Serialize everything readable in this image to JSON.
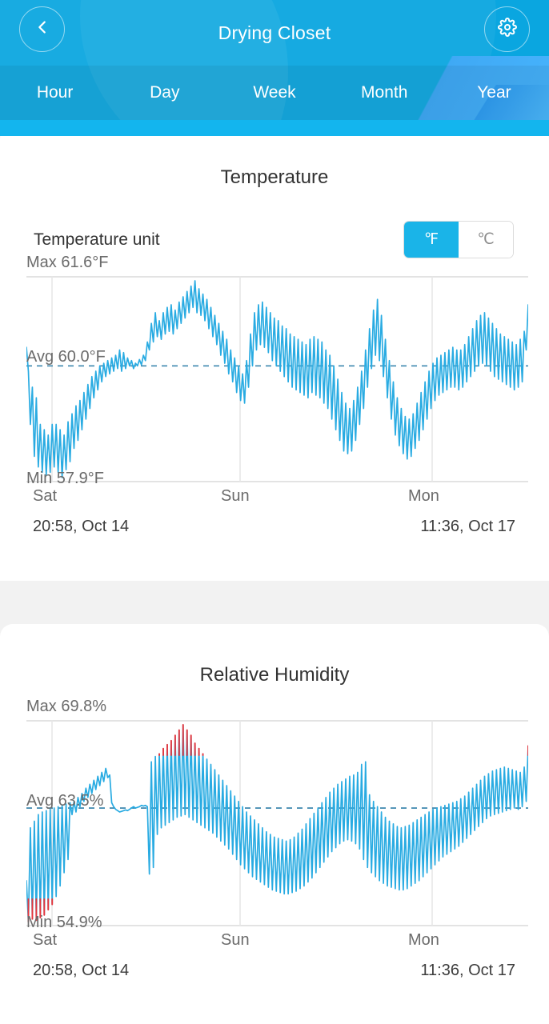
{
  "header": {
    "title": "Drying Closet",
    "back_icon": "chevron-left-icon",
    "settings_icon": "gear-icon",
    "accent": "#0aa6e0",
    "tabs": [
      {
        "label": "Hour",
        "selected": false
      },
      {
        "label": "Day",
        "selected": false
      },
      {
        "label": "Week",
        "selected": false
      },
      {
        "label": "Month",
        "selected": false
      },
      {
        "label": "Year",
        "selected": false
      }
    ]
  },
  "temperature": {
    "title": "Temperature",
    "unit_label": "Temperature unit",
    "unit_options": [
      {
        "label": "℉",
        "selected": true
      },
      {
        "label": "℃",
        "selected": false
      }
    ],
    "max_label": "Max 61.6°F",
    "avg_label": "Avg 60.0°F",
    "min_label": "Min 57.9°F",
    "axis": {
      "left_day": "Sat",
      "left_time": "20:58,  Oct 14",
      "mid_day": "Sun",
      "right_day": "Mon",
      "right_time": "11:36,  Oct 17"
    }
  },
  "humidity": {
    "title": "Relative Humidity",
    "max_label": "Max 69.8%",
    "avg_label": "Avg 63.5%",
    "min_label": "Min 54.9%",
    "axis": {
      "left_day": "Sat",
      "left_time": "20:58,  Oct 14",
      "mid_day": "Sun",
      "right_day": "Mon",
      "right_time": "11:36,  Oct 17"
    }
  },
  "chart_data": [
    {
      "type": "line",
      "title": "Temperature",
      "ylabel": "°F",
      "xlabel": "",
      "grid": true,
      "legend": "none",
      "series_color": "#29abe2",
      "avg_line_style": "dashed",
      "ylim": [
        57.9,
        61.6
      ],
      "stats": {
        "max": 61.6,
        "avg": 60.0,
        "min": 57.9,
        "unit": "°F"
      },
      "xticks": [
        "Sat",
        "Sun",
        "Mon"
      ],
      "xtick_sublabels": [
        "20:58,  Oct 14",
        "",
        "11:36,  Oct 17"
      ],
      "x_range": [
        "2023-10-14 20:58",
        "2023-10-17 11:36"
      ],
      "series": [
        {
          "name": "Temperature",
          "values": [
            60.35,
            59.9,
            58.9,
            59.6,
            58.3,
            59.4,
            58.1,
            58.9,
            58.0,
            58.8,
            57.95,
            58.7,
            58.0,
            58.9,
            58.1,
            58.9,
            58.0,
            58.8,
            57.9,
            58.7,
            58.05,
            58.95,
            58.2,
            59.1,
            58.45,
            59.25,
            58.6,
            59.35,
            58.8,
            59.5,
            59.0,
            59.65,
            59.2,
            59.8,
            59.4,
            59.9,
            59.55,
            60.0,
            59.7,
            60.05,
            59.8,
            60.1,
            59.85,
            60.15,
            59.9,
            60.2,
            59.95,
            60.3,
            59.9,
            60.25,
            59.95,
            60.15,
            60.0,
            60.1,
            59.95,
            60.05,
            60.0,
            60.12,
            60.02,
            60.2,
            60.1,
            60.45,
            60.3,
            60.8,
            60.45,
            61.0,
            60.55,
            60.85,
            60.5,
            61.0,
            60.6,
            61.1,
            60.65,
            61.15,
            60.6,
            61.05,
            60.7,
            61.2,
            60.8,
            61.3,
            60.9,
            61.4,
            61.0,
            61.5,
            61.1,
            61.6,
            61.0,
            61.45,
            60.95,
            61.35,
            60.85,
            61.25,
            60.7,
            61.1,
            60.55,
            60.95,
            60.4,
            60.8,
            60.2,
            60.65,
            60.05,
            60.5,
            59.85,
            60.3,
            59.7,
            60.15,
            59.5,
            60.0,
            59.35,
            59.85,
            59.3,
            60.1,
            59.6,
            60.6,
            60.0,
            61.0,
            60.3,
            61.15,
            60.4,
            61.2,
            60.35,
            61.1,
            60.25,
            61.0,
            60.1,
            60.9,
            60.0,
            60.85,
            59.9,
            60.75,
            59.8,
            60.7,
            59.7,
            60.6,
            59.6,
            60.55,
            59.55,
            60.5,
            59.5,
            60.45,
            59.45,
            60.4,
            59.4,
            60.5,
            59.5,
            60.55,
            59.45,
            60.5,
            59.4,
            60.45,
            59.3,
            60.3,
            59.2,
            60.2,
            59.0,
            60.0,
            58.8,
            59.75,
            58.6,
            59.5,
            58.4,
            59.3,
            58.35,
            59.2,
            58.4,
            59.35,
            58.6,
            59.6,
            58.9,
            59.9,
            59.2,
            60.3,
            59.6,
            60.7,
            59.95,
            61.05,
            60.2,
            61.25,
            60.1,
            60.95,
            59.8,
            60.5,
            59.4,
            60.1,
            59.0,
            59.7,
            58.7,
            59.4,
            58.5,
            59.2,
            58.35,
            59.05,
            58.25,
            59.0,
            58.3,
            59.1,
            58.45,
            59.3,
            58.6,
            59.5,
            58.8,
            59.7,
            59.0,
            59.9,
            59.2,
            60.05,
            59.35,
            60.15,
            59.45,
            60.2,
            59.5,
            60.25,
            59.55,
            60.3,
            59.6,
            60.35,
            59.6,
            60.3,
            59.55,
            60.3,
            59.6,
            60.4,
            59.7,
            60.55,
            59.8,
            60.7,
            59.9,
            60.85,
            60.0,
            60.95,
            60.05,
            61.0,
            60.0,
            60.9,
            59.9,
            60.8,
            59.8,
            60.7,
            59.75,
            60.6,
            59.7,
            60.55,
            59.65,
            60.5,
            59.6,
            60.45,
            59.55,
            60.4,
            59.6,
            60.5,
            59.7,
            60.65,
            60.3,
            61.15
          ]
        }
      ]
    },
    {
      "type": "line",
      "title": "Relative Humidity",
      "ylabel": "%",
      "xlabel": "",
      "grid": true,
      "legend": "none",
      "series_color": "#29abe2",
      "alert_color": "#e8363c",
      "alert_high_threshold": 67.5,
      "alert_low_threshold": 56.6,
      "avg_line_style": "dashed",
      "ylim": [
        54.9,
        69.8
      ],
      "stats": {
        "max": 69.8,
        "avg": 63.5,
        "min": 54.9,
        "unit": "%"
      },
      "xticks": [
        "Sat",
        "Sun",
        "Mon"
      ],
      "xtick_sublabels": [
        "20:58,  Oct 14",
        "",
        "11:36,  Oct 17"
      ],
      "x_range": [
        "2023-10-14 20:58",
        "2023-10-17 11:36"
      ],
      "series": [
        {
          "name": "Relative Humidity",
          "values": [
            58.0,
            54.9,
            62.0,
            55.1,
            62.5,
            55.0,
            63.0,
            55.2,
            63.2,
            55.4,
            63.3,
            55.8,
            63.4,
            56.2,
            63.5,
            56.8,
            63.6,
            57.6,
            63.7,
            58.6,
            63.8,
            59.6,
            63.9,
            63.0,
            64.0,
            63.2,
            64.3,
            63.6,
            64.6,
            64.0,
            65.0,
            64.3,
            65.3,
            64.6,
            65.6,
            64.9,
            65.9,
            65.2,
            66.2,
            65.5,
            66.5,
            65.8,
            66.0,
            63.9,
            63.6,
            63.4,
            63.3,
            63.2,
            63.25,
            63.3,
            63.35,
            63.3,
            63.4,
            63.5,
            63.6,
            63.5,
            63.55,
            63.6,
            63.7,
            63.65,
            63.7,
            63.6,
            58.5,
            67.0,
            59.0,
            67.4,
            61.5,
            67.6,
            62.0,
            68.0,
            62.2,
            68.3,
            62.4,
            68.6,
            62.6,
            69.0,
            62.8,
            69.4,
            62.9,
            69.8,
            63.0,
            69.4,
            62.8,
            69.0,
            62.6,
            68.4,
            62.4,
            68.0,
            62.2,
            67.6,
            62.0,
            67.2,
            61.8,
            66.8,
            61.6,
            66.4,
            61.3,
            66.0,
            61.0,
            65.6,
            60.7,
            65.2,
            60.4,
            64.8,
            60.0,
            64.4,
            59.6,
            64.0,
            59.2,
            63.6,
            58.9,
            63.2,
            58.6,
            62.9,
            58.3,
            62.6,
            58.1,
            62.3,
            57.9,
            62.0,
            57.7,
            61.7,
            57.5,
            61.5,
            57.3,
            61.3,
            57.2,
            61.2,
            57.1,
            61.1,
            57.0,
            61.0,
            57.0,
            61.1,
            57.1,
            61.3,
            57.2,
            61.6,
            57.4,
            61.9,
            57.6,
            62.3,
            57.9,
            62.7,
            58.2,
            63.1,
            58.6,
            63.5,
            59.0,
            63.9,
            59.4,
            64.3,
            59.8,
            64.7,
            60.2,
            65.0,
            60.5,
            65.3,
            60.8,
            65.5,
            61.0,
            65.7,
            61.1,
            65.9,
            61.0,
            66.0,
            60.8,
            66.2,
            60.4,
            66.8,
            59.6,
            67.0,
            59.0,
            64.5,
            58.6,
            64.0,
            58.3,
            63.6,
            58.0,
            63.2,
            57.8,
            62.8,
            57.6,
            62.5,
            57.5,
            62.3,
            57.4,
            62.1,
            57.3,
            62.0,
            57.3,
            62.1,
            57.4,
            62.2,
            57.6,
            62.4,
            57.8,
            62.6,
            58.0,
            62.8,
            58.3,
            63.0,
            58.6,
            63.2,
            58.9,
            63.4,
            59.2,
            63.5,
            59.5,
            63.6,
            59.8,
            63.7,
            60.0,
            63.8,
            60.2,
            63.9,
            60.4,
            64.0,
            60.6,
            64.2,
            60.9,
            64.4,
            61.2,
            64.7,
            61.5,
            65.0,
            61.8,
            65.3,
            62.1,
            65.6,
            62.4,
            65.9,
            62.7,
            66.1,
            62.9,
            66.3,
            63.0,
            66.4,
            63.1,
            66.5,
            63.2,
            66.6,
            63.3,
            66.5,
            63.4,
            66.4,
            63.5,
            66.3,
            63.4,
            66.2,
            63.6,
            66.6,
            64.0,
            68.2
          ]
        }
      ]
    }
  ]
}
